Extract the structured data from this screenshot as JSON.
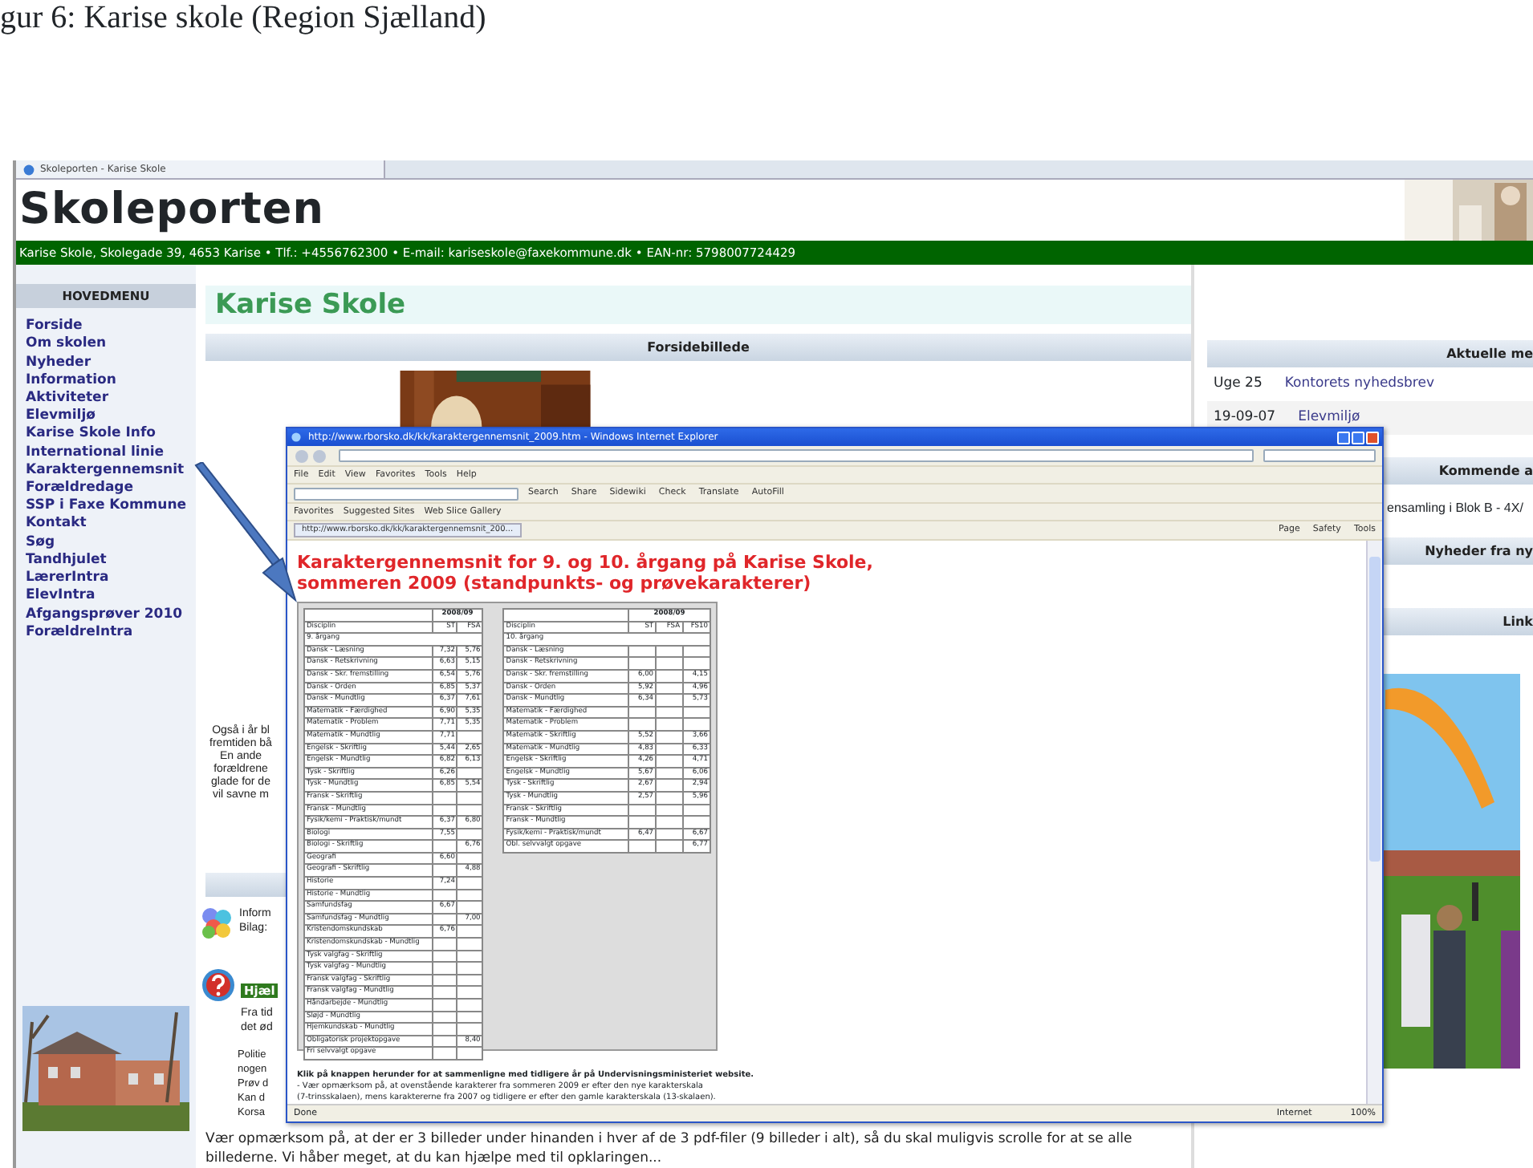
{
  "caption": "gur 6: Karise skole (Region Sjælland)",
  "browser_tab": "Skoleporten - Karise Skole",
  "site": {
    "logo": "Skoleporten",
    "contact": "Karise Skole, Skolegade 39, 4653 Karise • Tlf.: +4556762300 • E-mail: kariseskole@faxekommune.dk • EAN-nr: 5798007724429"
  },
  "sidebar": {
    "title": "HOVEDMENU",
    "items": [
      "Forside",
      "Om skolen",
      "Nyheder",
      "Information",
      "Aktiviteter",
      "Elevmiljø",
      "Karise Skole Info",
      "International linie",
      "Karaktergennemsnit",
      "Forældredage",
      "SSP i Faxe Kommune",
      "Kontakt",
      "Søg",
      "Tandhjulet",
      "LærerIntra",
      "ElevIntra",
      "Afgangsprøver 2010",
      "ForældreIntra"
    ]
  },
  "main": {
    "title": "Karise Skole",
    "photo_section": "Forsidebillede",
    "intro_lines": [
      "Også i år bl",
      "fremtiden bå",
      "En ande",
      "forældrene",
      "glade for de",
      "vil savne m"
    ],
    "info_lines": [
      "Inform",
      "Bilag:"
    ],
    "help_tag": "Hjæl",
    "help_lines": [
      "Fra tid",
      "det ød"
    ],
    "help_more": [
      "Politie",
      "nogen",
      "Prøv d",
      "Kan d",
      "Korsa"
    ],
    "notice": [
      "Vær opmærksom på, at der er 3 billeder under hinanden i hver af de 3 pdf-filer (9 billeder i alt), så du skal muligvis scrolle for at se alle",
      "billederne. Vi håber meget, at du kan hjælpe med til opklaringen..."
    ]
  },
  "right": {
    "news_title": "Aktuelle me",
    "news": [
      {
        "date": "Uge 25",
        "title": "Kontorets nyhedsbrev"
      },
      {
        "date": "19-09-07",
        "title": "Elevmiljø"
      }
    ],
    "upcoming_title": "Kommende a",
    "upcoming": "ensamling i Blok B - 4X/",
    "newsletter_title": "Nyheder fra ny",
    "links_title": "Link"
  },
  "ie_window": {
    "title": "http://www.rborsko.dk/kk/karaktergennemsnit_2009.htm - Windows Internet Explorer",
    "menu": [
      "File",
      "Edit",
      "View",
      "Favorites",
      "Tools",
      "Help"
    ],
    "toolbar": [
      "Search",
      "Share",
      "Sidewiki",
      "Check",
      "Translate",
      "AutoFill"
    ],
    "favorites": [
      "Favorites",
      "Suggested Sites",
      "Web Slice Gallery"
    ],
    "tab": "http://www.rborsko.dk/kk/karaktergennemsnit_200...",
    "commands": [
      "Page",
      "Safety",
      "Tools"
    ],
    "heading": [
      "Karaktergennemsnit for 9. og 10. årgang på Karise Skole,",
      "sommeren 2009 (standpunkts- og prøvekarakterer)"
    ],
    "tables": [
      {
        "year": "2008/09",
        "columns": [
          "Disciplin",
          "ST",
          "FSA"
        ],
        "grade": "9. årgang",
        "rows": [
          {
            "subject": "Dansk - Læsning",
            "st": "7,32",
            "fsa": "5,76"
          },
          {
            "subject": "Dansk - Retskrivning",
            "st": "6,63",
            "fsa": "5,15"
          },
          {
            "subject": "Dansk - Skr. fremstilling",
            "st": "6,54",
            "fsa": "5,76"
          },
          {
            "subject": "Dansk - Orden",
            "st": "6,85",
            "fsa": "5,37"
          },
          {
            "subject": "Dansk - Mundtlig",
            "st": "6,37",
            "fsa": "7,61"
          },
          {
            "subject": "Matematik - Færdighed",
            "st": "6,90",
            "fsa": "5,35"
          },
          {
            "subject": "Matematik - Problem",
            "st": "7,71",
            "fsa": "5,35"
          },
          {
            "subject": "Matematik - Mundtlig",
            "st": "7,71"
          },
          {
            "subject": "Engelsk - Skriftlig",
            "st": "5,44",
            "fsa": "2,65"
          },
          {
            "subject": "Engelsk - Mundtlig",
            "st": "6,82",
            "fsa": "6,13"
          },
          {
            "subject": "Tysk - Skriftlig",
            "st": "6,26"
          },
          {
            "subject": "Tysk - Mundtlig",
            "st": "6,85",
            "fsa": "5,54"
          },
          {
            "subject": "Fransk - Skriftlig"
          },
          {
            "subject": "Fransk - Mundtlig"
          },
          {
            "subject": "Fysik/kemi - Praktisk/mundt",
            "st": "6,37",
            "fsa": "6,80"
          },
          {
            "subject": "Biologi",
            "st": "7,55"
          },
          {
            "subject": "Biologi - Skriftlig",
            "fsa": "6,76"
          },
          {
            "subject": "Geografi",
            "st": "6,60"
          },
          {
            "subject": "Geografi - Skriftlig",
            "fsa": "4,88"
          },
          {
            "subject": "Historie",
            "st": "7,24"
          },
          {
            "subject": "Historie - Mundtlig"
          },
          {
            "subject": "Samfundsfag",
            "st": "6,67"
          },
          {
            "subject": "Samfundsfag - Mundtlig",
            "fsa": "7,00"
          },
          {
            "subject": "Kristendomskundskab",
            "st": "6,76"
          },
          {
            "subject": "Kristendomskundskab - Mundtlig"
          },
          {
            "subject": "Tysk valgfag - Skriftlig"
          },
          {
            "subject": "Tysk valgfag - Mundtlig"
          },
          {
            "subject": "Fransk valgfag - Skriftlig"
          },
          {
            "subject": "Fransk valgfag - Mundtlig"
          },
          {
            "subject": "Håndarbejde - Mundtlig"
          },
          {
            "subject": "Sløjd - Mundtlig"
          },
          {
            "subject": "Hjemkundskab - Mundtlig"
          },
          {
            "subject": "Obligatorisk projektopgave",
            "fsa": "8,40"
          },
          {
            "subject": "Fri selvvalgt opgave"
          }
        ]
      },
      {
        "year": "2008/09",
        "columns": [
          "Disciplin",
          "ST",
          "FSA",
          "FS10"
        ],
        "grade": "10. årgang",
        "rows": [
          {
            "subject": "Dansk - Læsning"
          },
          {
            "subject": "Dansk - Retskrivning"
          },
          {
            "subject": "Dansk - Skr. fremstilling",
            "st": "6,00",
            "fs10": "4,15"
          },
          {
            "subject": "Dansk - Orden",
            "st": "5,92",
            "fs10": "4,96"
          },
          {
            "subject": "Dansk - Mundtlig",
            "st": "6,34",
            "fs10": "5,73"
          },
          {
            "subject": "Matematik - Færdighed"
          },
          {
            "subject": "Matematik - Problem"
          },
          {
            "subject": "Matematik - Skriftlig",
            "st": "5,52",
            "fs10": "3,66"
          },
          {
            "subject": "Matematik - Mundtlig",
            "st": "4,83",
            "fs10": "6,33"
          },
          {
            "subject": "Engelsk - Skriftlig",
            "st": "4,26",
            "fs10": "4,71"
          },
          {
            "subject": "Engelsk - Mundtlig",
            "st": "5,67",
            "fs10": "6,06"
          },
          {
            "subject": "Tysk - Skriftlig",
            "st": "2,67",
            "fs10": "2,94"
          },
          {
            "subject": "Tysk - Mundtlig",
            "st": "2,57",
            "fs10": "5,96"
          },
          {
            "subject": "Fransk - Skriftlig"
          },
          {
            "subject": "Fransk - Mundtlig"
          },
          {
            "subject": "Fysik/kemi - Praktisk/mundt",
            "st": "6,47",
            "fs10": "6,67"
          },
          {
            "subject": "Obl. selvvalgt opgave",
            "fs10": "6,77"
          }
        ]
      }
    ],
    "footer": [
      "Klik på knappen herunder for at sammenligne med tidligere år på Undervisningsministeriet website.",
      "- Vær opmærksom på, at ovenstående karakterer fra sommeren 2009 er efter den nye karakterskala",
      "(7-trinsskalaen), mens karaktererne fra 2007 og tidligere er efter den gamle karakterskala (13-skalaen)."
    ],
    "status": [
      "Done",
      "Internet",
      "100%"
    ]
  }
}
